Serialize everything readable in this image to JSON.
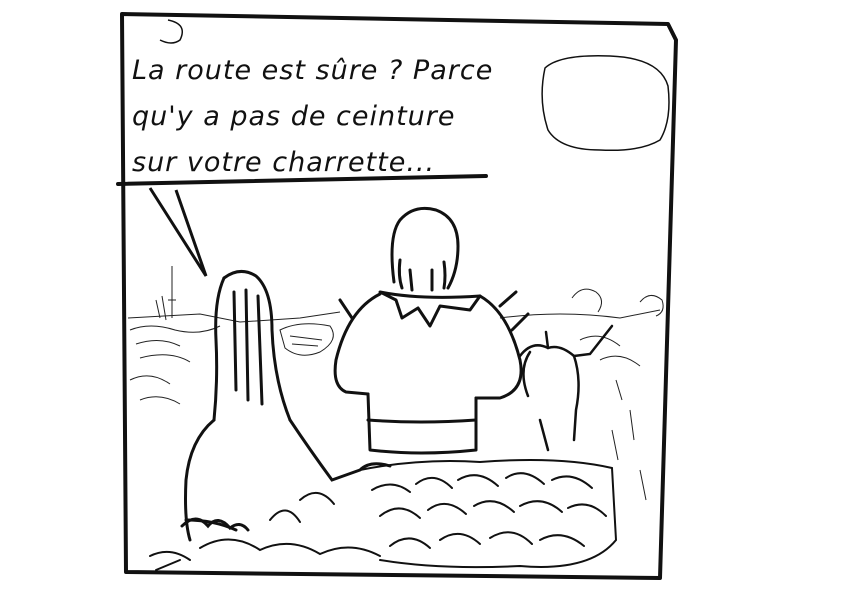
{
  "panel": {
    "speech_lines": [
      "La route est sûre ? Parce",
      "qu'y a pas de ceinture",
      "sur votre charrette..."
    ]
  },
  "colors": {
    "ink": "#111111",
    "paper": "#ffffff"
  }
}
